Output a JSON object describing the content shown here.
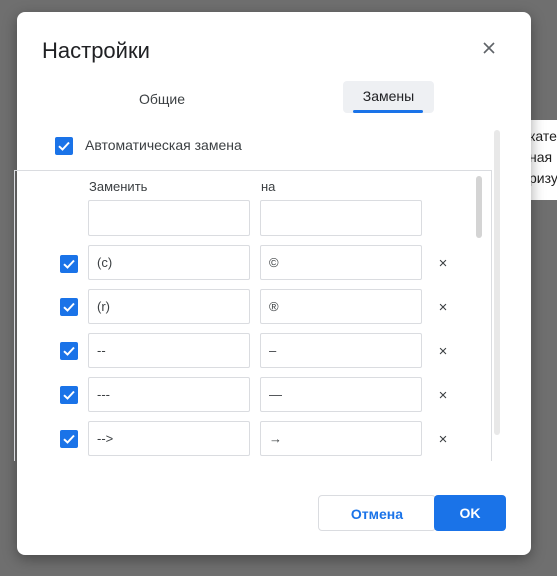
{
  "background_doc": {
    "fragments": [
      "кате",
      "ная",
      "ризу"
    ]
  },
  "dialog": {
    "title": "Настройки",
    "close_icon": "close-icon",
    "tabs": [
      {
        "label": "Общие",
        "active": false
      },
      {
        "label": "Замены",
        "active": true
      }
    ],
    "auto_replace": {
      "label": "Автоматическая замена",
      "checked": true
    },
    "columns": {
      "replace": "Заменить",
      "with": "на"
    },
    "new_row": {
      "replace": "",
      "with": ""
    },
    "rows": [
      {
        "checked": true,
        "replace": "(c)",
        "with": "©",
        "delete": "×"
      },
      {
        "checked": true,
        "replace": "(r)",
        "with": "®",
        "delete": "×"
      },
      {
        "checked": true,
        "replace": "--",
        "with": "–",
        "delete": "×"
      },
      {
        "checked": true,
        "replace": "---",
        "with": "—",
        "delete": "×"
      },
      {
        "checked": true,
        "replace": "-->",
        "with": "→",
        "delete": "×"
      }
    ],
    "buttons": {
      "cancel": "Отмена",
      "ok": "OK"
    },
    "colors": {
      "accent": "#1a73e8",
      "overlay": "#6f6f6f"
    }
  }
}
